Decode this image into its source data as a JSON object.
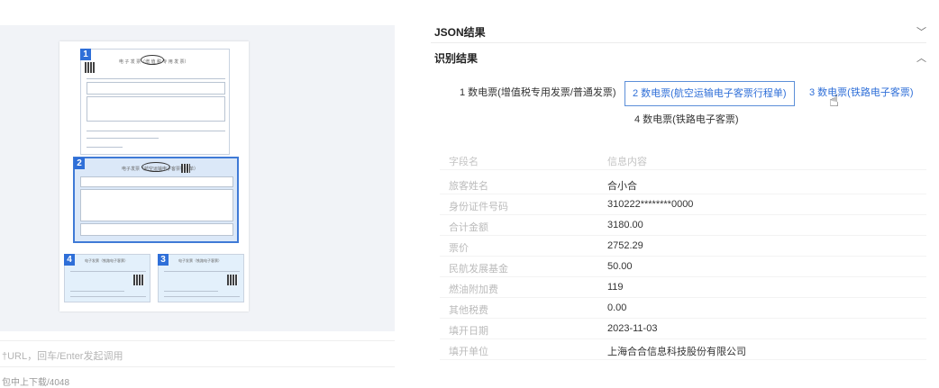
{
  "left": {
    "invoices": [
      {
        "num": "1",
        "title": "电 子 发 票（增 值 税 专 用 发 票）"
      },
      {
        "num": "2",
        "title": "电子发票（航空运输电子客票行程单）"
      },
      {
        "num": "3",
        "title": "电子发票（铁路电子客票）"
      },
      {
        "num": "4",
        "title": "电子发票（铁路电子客票）"
      }
    ],
    "url_placeholder": "†URL，回车/Enter发起调用",
    "foot_text": "包中上下载/4048"
  },
  "right": {
    "json_section": {
      "title": "JSON结果",
      "arrow": "﹀"
    },
    "result_section": {
      "title": "识别结果",
      "arrow": "︿"
    },
    "tabs": [
      {
        "label": "1 数电票(增值税专用发票/普通发票)"
      },
      {
        "label": "2 数电票(航空运输电子客票行程单)"
      },
      {
        "label": "3 数电票(铁路电子客票)"
      },
      {
        "label": "4 数电票(铁路电子客票)"
      }
    ],
    "table": {
      "header": {
        "key": "字段名",
        "value": "信息内容"
      },
      "rows": [
        {
          "key": "旅客姓名",
          "value": "合小合"
        },
        {
          "key": "身份证件号码",
          "value": "310222********0000"
        },
        {
          "key": "合计金额",
          "value": "3180.00"
        },
        {
          "key": "票价",
          "value": "2752.29"
        },
        {
          "key": "民航发展基金",
          "value": "50.00"
        },
        {
          "key": "燃油附加费",
          "value": "119"
        },
        {
          "key": "其他税费",
          "value": "0.00"
        },
        {
          "key": "填开日期",
          "value": "2023-11-03"
        },
        {
          "key": "填开单位",
          "value": "上海合合信息科技股份有限公司"
        }
      ]
    }
  }
}
